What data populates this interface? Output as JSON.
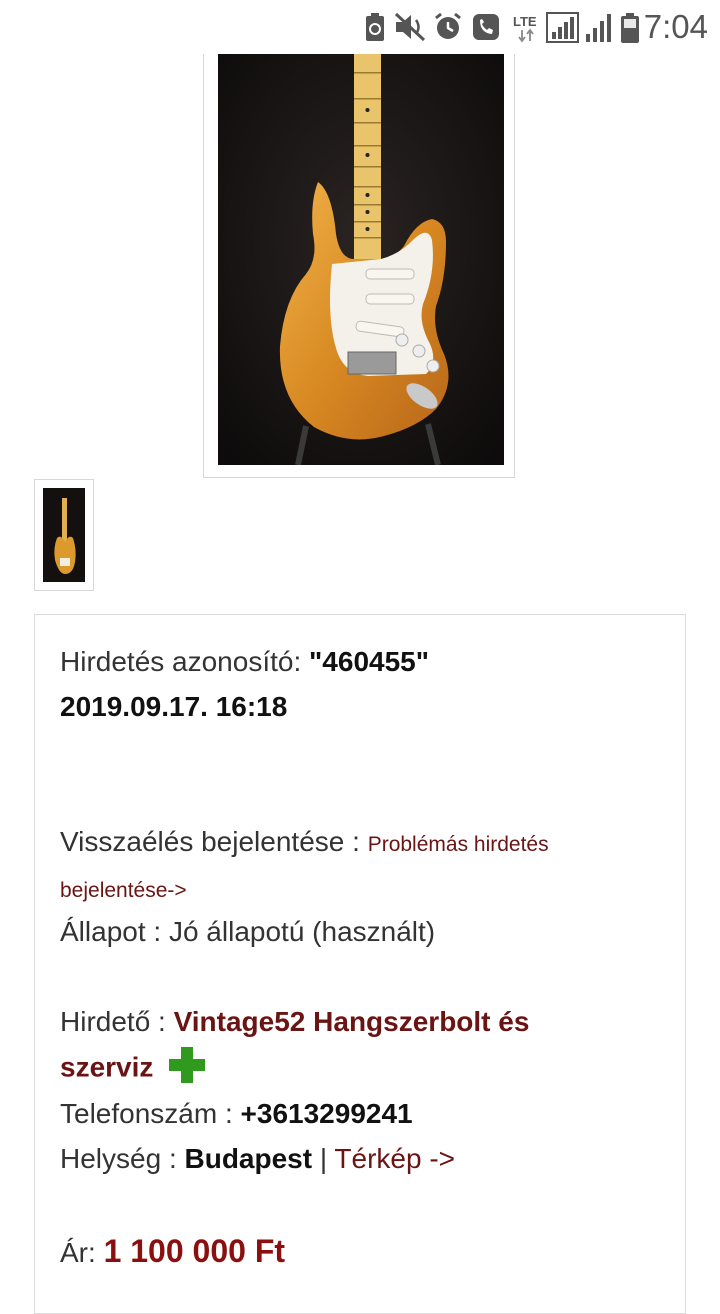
{
  "status_bar": {
    "time": "7:04",
    "network": "LTE",
    "icons": [
      "battery-saver-icon",
      "mute-icon",
      "alarm-icon",
      "call-icon",
      "lte-icon",
      "signal-icon",
      "signal-icon",
      "battery-icon"
    ]
  },
  "gallery": {
    "main_image": "guitar-front-photo",
    "thumbnails": [
      "guitar-back-photo"
    ]
  },
  "ad": {
    "id_label": "Hirdetés azonosító:",
    "id_value": "\"460455\"",
    "date": "2019.09.17. 16:18",
    "report_label": "Visszaélés bejelentése :",
    "report_link_line1": "Problémás hirdetés",
    "report_link_line2": "bejelentése->",
    "condition_label": "Állapot :",
    "condition_value": "Jó állapotú (használt)",
    "advertiser_label": "Hirdető :",
    "advertiser_line1": "Vintage52 Hangszerbolt és",
    "advertiser_line2": "szerviz",
    "phone_label": "Telefonszám :",
    "phone_value": "+3613299241",
    "location_label": "Helység :",
    "location_value": "Budapest",
    "separator": "|",
    "map_link": "Térkép ->",
    "price_label": "Ár:",
    "price_value": "1 100 000 Ft"
  }
}
